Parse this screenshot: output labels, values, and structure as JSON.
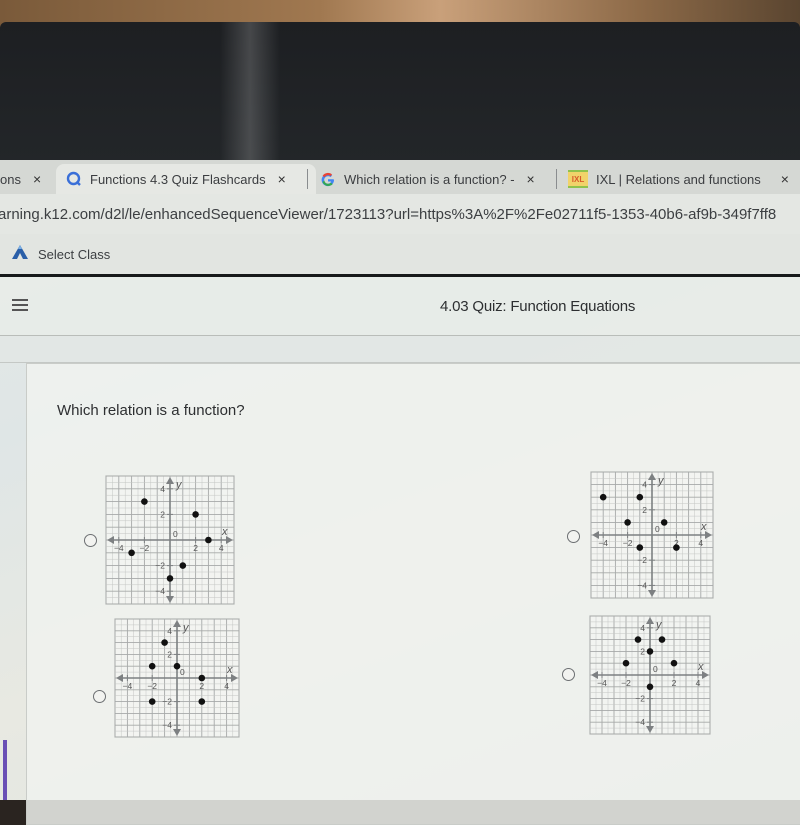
{
  "browser": {
    "tabs": [
      {
        "label": "ons",
        "favicon": "none",
        "active": false
      },
      {
        "label": "Functions 4.3 Quiz Flashcards",
        "favicon": "quizlet-q-icon",
        "active": true
      },
      {
        "label": "Which relation is a function? -",
        "favicon": "google-g-icon",
        "active": false
      },
      {
        "label": "IXL | Relations and functions",
        "favicon": "ixl-icon",
        "active": false
      }
    ],
    "close_glyph": "×",
    "url": "arning.k12.com/d2l/le/enhancedSequenceViewer/1723113?url=https%3A%2F%2Fe02711f5-1353-40b6-af9b-349f7ff8",
    "bookmarks": [
      {
        "label": "Select Class",
        "icon": "k12-logo-icon"
      }
    ]
  },
  "app": {
    "title": "4.03 Quiz: Function Equations",
    "menu_icon": "hamburger-menu-icon"
  },
  "question": {
    "prompt": "Which relation is a function?",
    "selected_option": null
  },
  "chart_data": [
    {
      "type": "scatter",
      "id": "option-a",
      "position": "top-left",
      "xlabel": "x",
      "ylabel": "y",
      "xlim": [
        -5,
        5
      ],
      "ylim": [
        -5,
        5
      ],
      "x_ticks": [
        -4,
        -2,
        2,
        4
      ],
      "y_ticks": [
        4,
        2,
        -2,
        -4
      ],
      "origin_label": "0",
      "grid": true,
      "points": [
        [
          -2,
          3
        ],
        [
          2,
          2
        ],
        [
          -3,
          -1
        ],
        [
          3,
          0
        ],
        [
          1,
          -2
        ],
        [
          0,
          -3
        ]
      ]
    },
    {
      "type": "scatter",
      "id": "option-b",
      "position": "top-right",
      "xlabel": "x",
      "ylabel": "y",
      "xlim": [
        -5,
        5
      ],
      "ylim": [
        -5,
        5
      ],
      "x_ticks": [
        -4,
        -2,
        2,
        4
      ],
      "y_ticks": [
        4,
        2,
        -2,
        -4
      ],
      "origin_label": "0",
      "grid": true,
      "points": [
        [
          -4,
          3
        ],
        [
          -1,
          3
        ],
        [
          -2,
          1
        ],
        [
          1,
          1
        ],
        [
          -1,
          -1
        ],
        [
          2,
          -1
        ]
      ]
    },
    {
      "type": "scatter",
      "id": "option-c",
      "position": "bottom-left",
      "xlabel": "x",
      "ylabel": "y",
      "xlim": [
        -5,
        5
      ],
      "ylim": [
        -5,
        5
      ],
      "x_ticks": [
        -4,
        -2,
        2,
        4
      ],
      "y_ticks": [
        4,
        2,
        -2,
        -4
      ],
      "origin_label": "0",
      "grid": true,
      "points": [
        [
          -1,
          3
        ],
        [
          -2,
          1
        ],
        [
          0,
          1
        ],
        [
          2,
          0
        ],
        [
          -2,
          -2
        ],
        [
          2,
          -2
        ]
      ]
    },
    {
      "type": "scatter",
      "id": "option-d",
      "position": "bottom-right",
      "xlabel": "x",
      "ylabel": "y",
      "xlim": [
        -5,
        5
      ],
      "ylim": [
        -5,
        5
      ],
      "x_ticks": [
        -4,
        -2,
        2,
        4
      ],
      "y_ticks": [
        4,
        2,
        -2,
        -4
      ],
      "origin_label": "0",
      "grid": true,
      "points": [
        [
          -1,
          3
        ],
        [
          1,
          3
        ],
        [
          0,
          2
        ],
        [
          -2,
          1
        ],
        [
          2,
          1
        ],
        [
          0,
          -1
        ]
      ]
    }
  ]
}
